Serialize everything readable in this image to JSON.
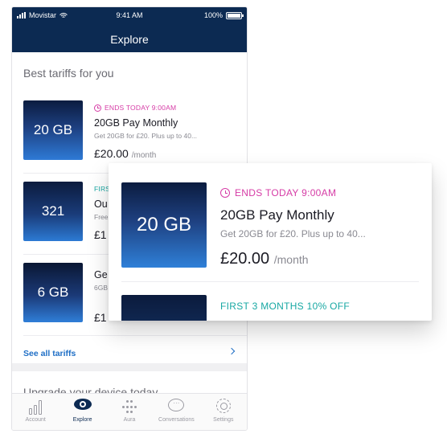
{
  "status_bar": {
    "carrier": "Movistar",
    "time": "9:41 AM",
    "battery": "100%",
    "battery_level": 1.0
  },
  "header": {
    "title": "Explore"
  },
  "tariffs_section": {
    "title": "Best tariffs for you",
    "items": [
      {
        "tile": "20 GB",
        "promo": "ENDS TODAY 9:00AM",
        "name": "20GB Pay Monthly",
        "desc": "Get 20GB for £20. Plus up to 40...",
        "price": "£20.00",
        "per": "/month"
      },
      {
        "tile": "321",
        "promo": "FIRS",
        "name": "Ou",
        "desc": "Free",
        "price": "£1",
        "per": ""
      },
      {
        "tile": "6 GB",
        "promo": "",
        "name": "Ge",
        "desc": "6GB",
        "price": "£1",
        "per": ""
      }
    ],
    "see_all": "See all tariffs"
  },
  "upgrade_section": {
    "title": "Upgrade your device today"
  },
  "tabbar": {
    "items": [
      {
        "label": "Account",
        "icon": "bar-chart-icon"
      },
      {
        "label": "Explore",
        "icon": "eye-icon"
      },
      {
        "label": "Aura",
        "icon": "aura-dots-icon"
      },
      {
        "label": "Conversations",
        "icon": "chat-bubble-icon"
      },
      {
        "label": "Settings",
        "icon": "gear-icon"
      }
    ],
    "active": "Explore"
  },
  "zoom_card": {
    "tile": "20 GB",
    "promo": "ENDS TODAY 9:00AM",
    "name": "20GB Pay Monthly",
    "desc": "Get 20GB for £20. Plus up to 40...",
    "price": "£20.00",
    "per": "/month",
    "next_promo": "FIRST 3 MONTHS 10% OFF"
  },
  "colors": {
    "header_bg": "#0c2a52",
    "promo_pink": "#d63ca6",
    "promo_teal": "#18a8a3",
    "link_blue": "#1f6fc6"
  }
}
